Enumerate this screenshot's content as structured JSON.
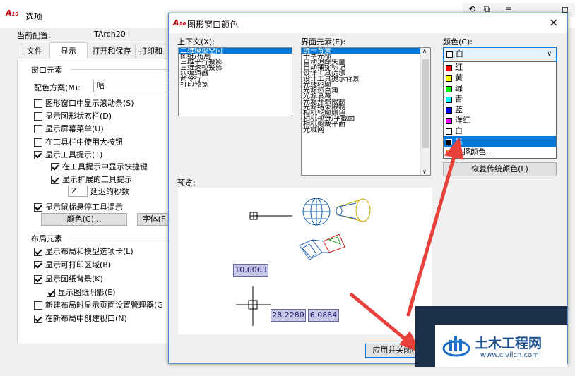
{
  "options_window": {
    "title": "选项",
    "current_profile_label": "当前配置:",
    "current_profile_value": "TArch20",
    "tabs": [
      "文件",
      "显示",
      "打开和保存",
      "打印和发"
    ],
    "window_elements": {
      "heading": "窗口元素",
      "color_scheme_label": "配色方案(M):",
      "color_scheme_value": "暗",
      "items": [
        {
          "label": "图形窗口中显示滚动条(S)",
          "checked": false
        },
        {
          "label": "显示图形状态栏(D)",
          "checked": false
        },
        {
          "label": "显示屏幕菜单(U)",
          "checked": false
        },
        {
          "label": "在工具栏中使用大按钮",
          "checked": false
        },
        {
          "label": "显示工具提示(T)",
          "checked": true
        },
        {
          "label": "在工具提示中显示快捷键",
          "checked": true
        },
        {
          "label": "显示扩展的工具提示",
          "checked": true
        }
      ],
      "delay_value": "2",
      "delay_label": "延迟的秒数",
      "hover_tooltip_label": "显示鼠标悬停工具提示",
      "colors_button": "颜色(C)...",
      "fonts_button": "字体(F"
    },
    "layout_elements": {
      "heading": "布局元素",
      "items": [
        {
          "label": "显示布局和模型选项卡(L)",
          "checked": true
        },
        {
          "label": "显示可打印区域(B)",
          "checked": true
        },
        {
          "label": "显示图纸背景(K)",
          "checked": true
        },
        {
          "label": "显示图纸阴影(E)",
          "checked": true
        },
        {
          "label": "新建布局时显示页面设置管理器(G",
          "checked": false
        },
        {
          "label": "在新布局中创建视口(N)",
          "checked": true
        }
      ]
    }
  },
  "color_dialog": {
    "title": "图形窗口颜色",
    "close_glyph": "×",
    "context_label": "上下文(X):",
    "context_items": [
      "二维模型空间",
      "图纸/布局",
      "三维平行投影",
      "三维透视投影",
      "块编辑器",
      "命令行",
      "打印预览"
    ],
    "interface_label": "界面元素(E):",
    "interface_items": [
      "统一背景",
      "十字光标",
      "自动追踪矢量",
      "自动捕捉标记",
      "设计工具提示",
      "设计工具提示背景",
      "光线轮廓",
      "光源热点角",
      "光源衰减",
      "光源开始限制",
      "光源结束限制",
      "相机轮廓颜色",
      "相机视野/平截面",
      "相机剪裁平面",
      "光域网"
    ],
    "color_label": "颜色(C):",
    "color_selected": "白",
    "color_options": [
      {
        "name": "红",
        "swatch": "#ff0000"
      },
      {
        "name": "黄",
        "swatch": "#ffff00"
      },
      {
        "name": "绿",
        "swatch": "#00ff00"
      },
      {
        "name": "青",
        "swatch": "#00ffff"
      },
      {
        "name": "蓝",
        "swatch": "#0000ff"
      },
      {
        "name": "洋红",
        "swatch": "#ff00ff"
      },
      {
        "name": "白",
        "swatch": "#ffffff"
      },
      {
        "name": "黑",
        "swatch": "#000000"
      },
      {
        "name": "选择颜色...",
        "swatch": "multi"
      }
    ],
    "restore_button": "恢复传统颜色(L)",
    "preview_label": "预览:",
    "preview_values": [
      "10.6063",
      "28.2280",
      "6.0884"
    ],
    "apply_close_button": "应用并关闭("
  },
  "watermark": {
    "title": "土木工程网",
    "url": "www.civilcn.com"
  },
  "colors": {
    "selection": "#0078d7",
    "arrow": "#e8413c"
  }
}
